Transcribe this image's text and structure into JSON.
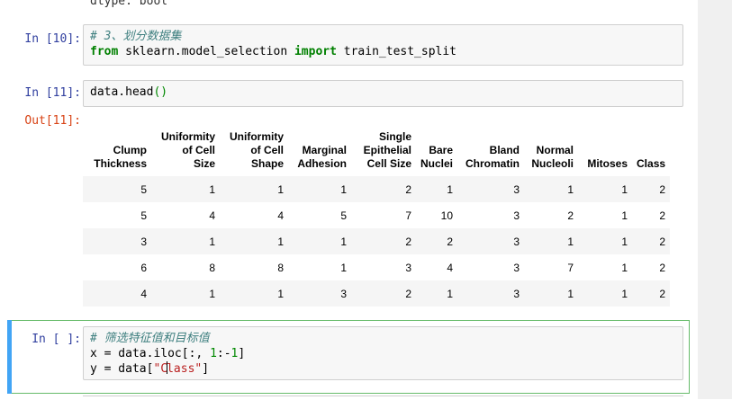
{
  "top_partial_text": "dtype: bool",
  "cells": {
    "in10": {
      "prompt": "In [10]:",
      "comment": "# 3、划分数据集",
      "kw_from": "from",
      "module": " sklearn.model_selection ",
      "kw_import": "import",
      "name": " train_test_split"
    },
    "in11": {
      "prompt": "In [11]:",
      "code_pre": "data.head",
      "code_parens": "()"
    },
    "out11": {
      "prompt": "Out[11]:"
    },
    "in_blank": {
      "prompt": "In [ ]:",
      "comment": "# 筛选特征值和目标值",
      "line2_pre": "x = data.iloc[:, ",
      "line2_num1": "1",
      "line2_mid": ":-",
      "line2_num2": "1",
      "line2_post": "]",
      "line3_pre": "y = data[",
      "line3_str_a": "\"C",
      "line3_str_b": "lass\"",
      "line3_post": "]"
    }
  },
  "table": {
    "columns": [
      [
        "Clump",
        "Thickness"
      ],
      [
        "Uniformity",
        "of Cell",
        "Size"
      ],
      [
        "Uniformity",
        "of Cell",
        "Shape"
      ],
      [
        "Marginal",
        "Adhesion"
      ],
      [
        "Single",
        "Epithelial",
        "Cell Size"
      ],
      [
        "Bare",
        "Nuclei"
      ],
      [
        "Bland",
        "Chromatin"
      ],
      [
        "Normal",
        "Nucleoli"
      ],
      [
        "Mitoses"
      ],
      [
        "Class"
      ]
    ],
    "rows": [
      [
        "5",
        "1",
        "1",
        "1",
        "2",
        "1",
        "3",
        "1",
        "1",
        "2"
      ],
      [
        "5",
        "4",
        "4",
        "5",
        "7",
        "10",
        "3",
        "2",
        "1",
        "2"
      ],
      [
        "3",
        "1",
        "1",
        "1",
        "2",
        "2",
        "3",
        "1",
        "1",
        "2"
      ],
      [
        "6",
        "8",
        "8",
        "1",
        "3",
        "4",
        "3",
        "7",
        "1",
        "2"
      ],
      [
        "4",
        "1",
        "1",
        "3",
        "2",
        "1",
        "3",
        "1",
        "1",
        "2"
      ]
    ]
  }
}
